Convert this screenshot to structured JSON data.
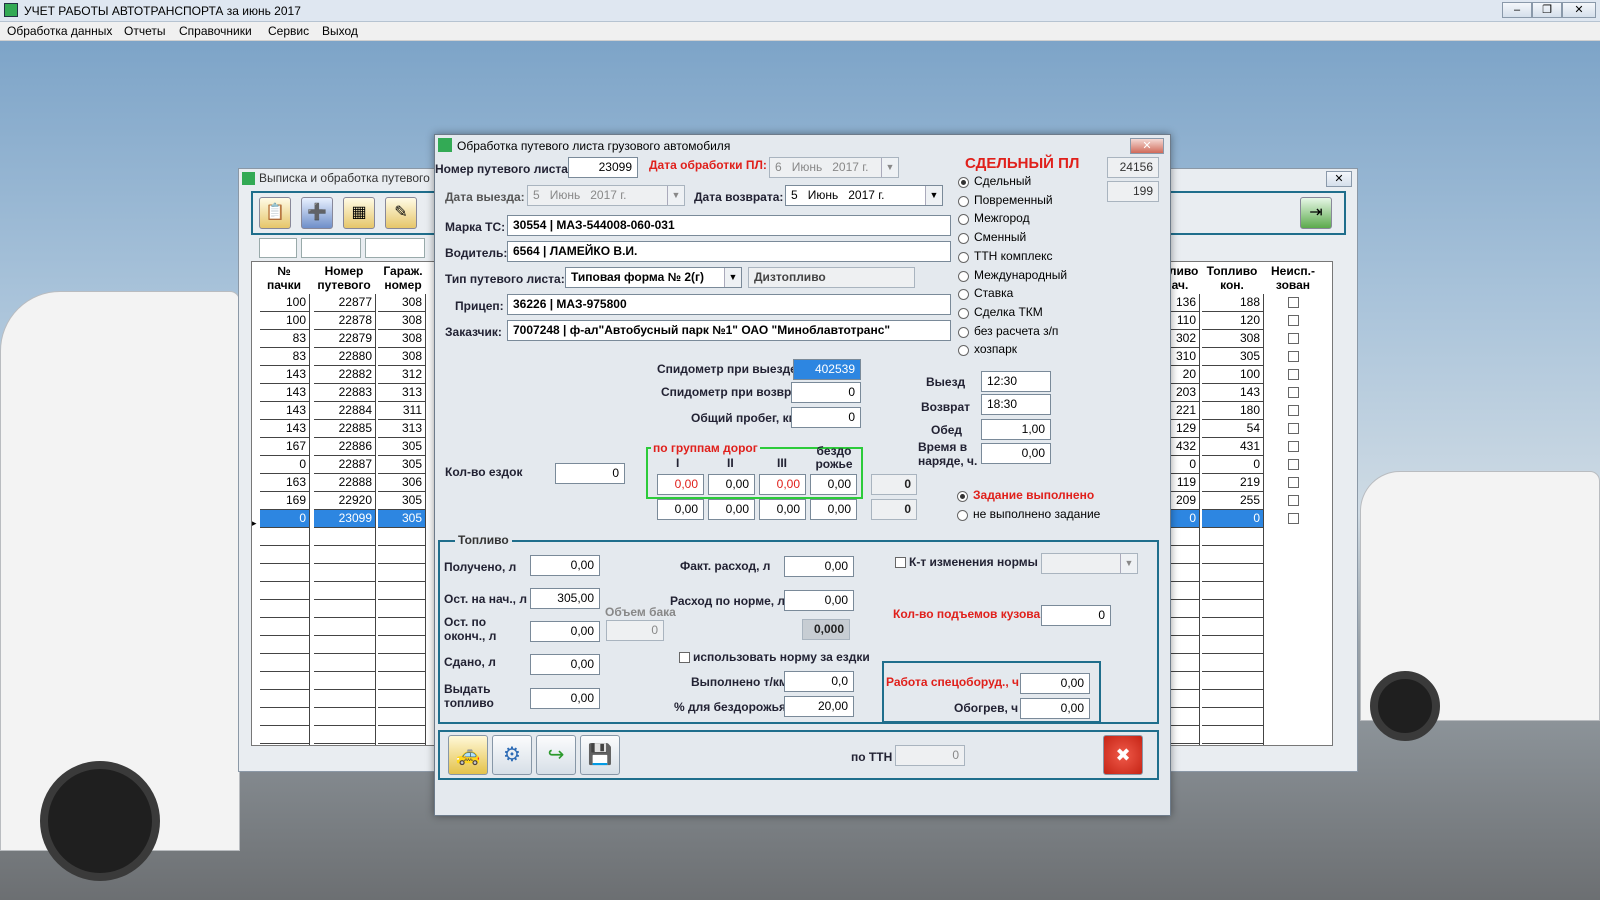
{
  "app": {
    "title": "УЧЕТ РАБОТЫ АВТОТРАНСПОРТА за июнь 2017",
    "menu": [
      "Обработка данных",
      "Отчеты",
      "Справочники",
      "Сервис",
      "Выход"
    ]
  },
  "back_window": {
    "title": "Выписка и обработка путевого",
    "columns_left": [
      "№ пачки",
      "Номер путевого",
      "Гараж. номер"
    ],
    "columns_right": [
      "пливо ач.",
      "Топливо кон.",
      "Неисп.- зован"
    ],
    "rows": [
      {
        "pack": "100",
        "num": "22877",
        "gar": "308",
        "fs": "136",
        "fe": "188"
      },
      {
        "pack": "100",
        "num": "22878",
        "gar": "308",
        "fs": "110",
        "fe": "120"
      },
      {
        "pack": "83",
        "num": "22879",
        "gar": "308",
        "fs": "302",
        "fe": "308"
      },
      {
        "pack": "83",
        "num": "22880",
        "gar": "308",
        "fs": "310",
        "fe": "305"
      },
      {
        "pack": "143",
        "num": "22882",
        "gar": "312",
        "fs": "20",
        "fe": "100"
      },
      {
        "pack": "143",
        "num": "22883",
        "gar": "313",
        "fs": "203",
        "fe": "143"
      },
      {
        "pack": "143",
        "num": "22884",
        "gar": "311",
        "fs": "221",
        "fe": "180"
      },
      {
        "pack": "143",
        "num": "22885",
        "gar": "313",
        "fs": "129",
        "fe": "54"
      },
      {
        "pack": "167",
        "num": "22886",
        "gar": "305",
        "fs": "432",
        "fe": "431"
      },
      {
        "pack": "0",
        "num": "22887",
        "gar": "305",
        "fs": "0",
        "fe": "0"
      },
      {
        "pack": "163",
        "num": "22888",
        "gar": "306",
        "fs": "119",
        "fe": "219"
      },
      {
        "pack": "169",
        "num": "22920",
        "gar": "305",
        "fs": "209",
        "fe": "255"
      },
      {
        "pack": "0",
        "num": "23099",
        "gar": "305",
        "fs": "0",
        "fe": "0"
      }
    ]
  },
  "dialog": {
    "title": "Обработка путевого листа грузового автомобиля",
    "labels": {
      "waybill_num": "Номер путевого листа:",
      "proc_date": "Дата обработки ПЛ:",
      "out_date": "Дата выезда:",
      "ret_date": "Дата возврата:",
      "vehicle": "Марка ТС:",
      "driver": "Водитель:",
      "waybill_type": "Тип путевого листа:",
      "trailer": "Прицеп:",
      "customer": "Заказчик:",
      "speedo_out": "Спидометр при выезде",
      "speedo_ret": "Спидометр при возвр.",
      "total_km": "Общий пробег, км",
      "trips": "Кол-во ездок",
      "road_groups": "по группам дорог",
      "g1": "I",
      "g2": "II",
      "g3": "III",
      "g4": "бездо рожье",
      "out_time": "Выезд",
      "ret_time": "Возврат",
      "lunch": "Обед",
      "order_time": "Время в наряде, ч.",
      "piece_title": "СДЕЛЬНЫЙ ПЛ"
    },
    "values": {
      "waybill_num": "23099",
      "proc_date": {
        "d": "6",
        "m": "Июнь",
        "y": "2017 г."
      },
      "out_date": {
        "d": "5",
        "m": "Июнь",
        "y": "2017 г."
      },
      "ret_date": {
        "d": "5",
        "m": "Июнь",
        "y": "2017 г."
      },
      "vehicle": "30554 | МАЗ-544008-060-031",
      "driver": "6564 | ЛАМЕЙКО В.И.",
      "waybill_type": "Типовая форма № 2(г)",
      "fuel_type": "Дизтопливо",
      "trailer": "36226 | МАЗ-975800",
      "customer": "7007248 | ф-ал\"Автобусный парк №1\" ОАО \"Миноблавтотранс\"",
      "speedo_out": "402539",
      "speedo_ret": "0",
      "total_km": "0",
      "trips": "0",
      "row1": [
        "0,00",
        "0,00",
        "0,00",
        "0,00",
        "0"
      ],
      "row2": [
        "0,00",
        "0,00",
        "0,00",
        "0,00",
        "0"
      ],
      "out_time": "12:30",
      "ret_time": "18:30",
      "lunch": "1,00",
      "order_time": "0,00",
      "side1": "24156",
      "side2": "199"
    },
    "pay_types": [
      "Сдельный",
      "Повременный",
      "Межгород",
      "Сменный",
      "ТТН комплекс",
      "Международный",
      "Ставка",
      "Сделка ТКМ",
      "без расчета з/п",
      "хозпарк"
    ],
    "task": [
      "Задание выполнено",
      "не выполнено задание"
    ],
    "fuel": {
      "legend": "Топливо",
      "received_lbl": "Получено, л",
      "received": "0,00",
      "start_lbl": "Ост. на нач., л",
      "start": "305,00",
      "end_lbl": "Ост. по оконч., л",
      "end": "0,00",
      "tank_lbl": "Объем бака",
      "tank": "0",
      "returned_lbl": "Сдано, л",
      "returned": "0,00",
      "issue_lbl": "Выдать топливо",
      "issue": "0,00",
      "actual_lbl": "Факт. расход, л",
      "actual": "0,00",
      "norm_lbl": "Расход по норме, л",
      "norm": "0,00",
      "diff": "0,000",
      "use_norm_lbl": "использовать норму за ездки",
      "tkm_lbl": "Выполнено т/км",
      "tkm": "0,0",
      "offroad_lbl": "% для бездорожья",
      "offroad": "20,00",
      "coef_lbl": "К-т изменения нормы",
      "lifts_lbl": "Кол-во подъемов кузова",
      "lifts": "0",
      "special_lbl": "Работа спецоборуд., ч",
      "special": "0,00",
      "heating_lbl": "Обогрев, ч",
      "heating": "0,00"
    },
    "ttn_lbl": "по ТТН",
    "ttn": "0"
  }
}
